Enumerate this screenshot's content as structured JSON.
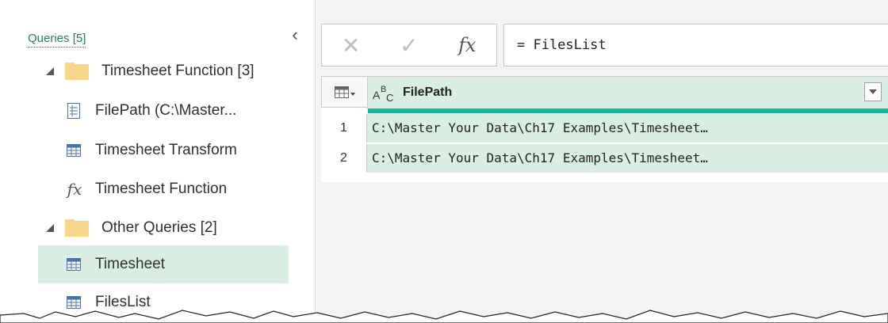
{
  "queries_pane": {
    "header": "Queries [5]",
    "collapse_icon": "chevron-left-icon",
    "groups": [
      {
        "label": "Timesheet Function [3]",
        "items": [
          {
            "label": "FilePath (C:\\Master...",
            "icon": "parameter-icon"
          },
          {
            "label": "Timesheet Transform",
            "icon": "table-icon"
          },
          {
            "label": "Timesheet Function",
            "icon": "function-icon"
          }
        ]
      },
      {
        "label": "Other Queries [2]",
        "items": [
          {
            "label": "Timesheet",
            "icon": "table-icon",
            "selected": true
          },
          {
            "label": "FilesList",
            "icon": "table-icon"
          }
        ]
      }
    ]
  },
  "formula_bar": {
    "cancel_icon": "close-icon",
    "commit_icon": "checkmark-icon",
    "fx_label": "fx",
    "formula": "= FilesList"
  },
  "grid": {
    "column": {
      "type_icon": "text-type-icon",
      "name": "FilePath"
    },
    "rows": [
      {
        "num": "1",
        "value": "C:\\Master Your Data\\Ch17 Examples\\Timesheet…"
      },
      {
        "num": "2",
        "value": "C:\\Master Your Data\\Ch17 Examples\\Timesheet…"
      }
    ]
  },
  "colors": {
    "accent_teal": "#17b59c",
    "selection_green": "#d9efe4",
    "header_link": "#2f7a6a",
    "folder_yellow": "#f7d68a"
  }
}
